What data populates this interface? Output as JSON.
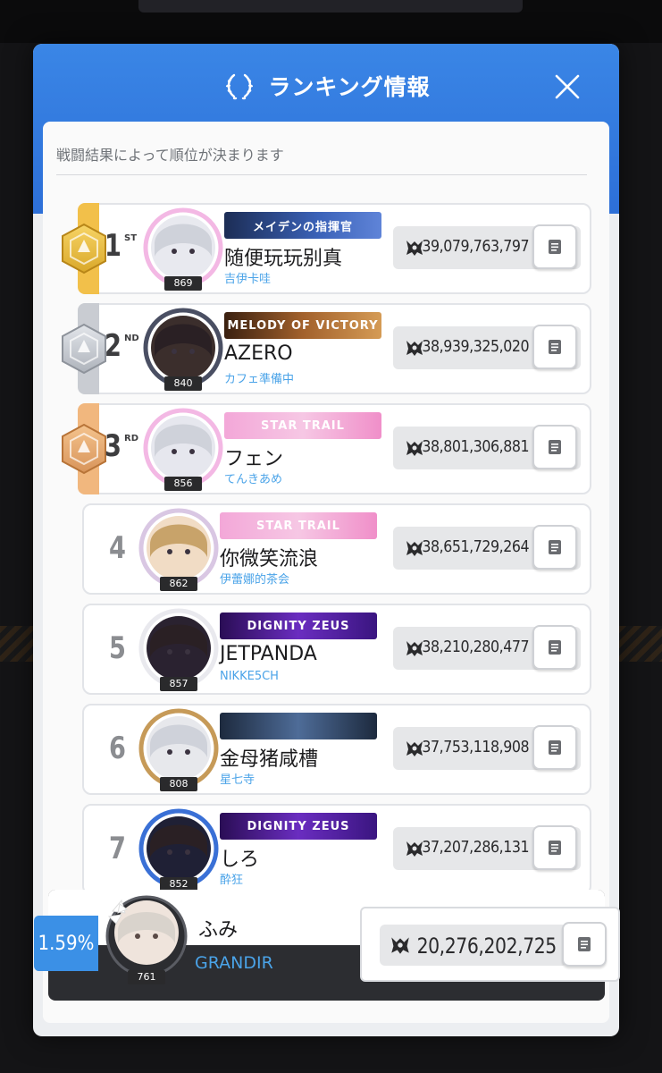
{
  "header": {
    "title": "ランキング情報",
    "close_icon": "close-icon",
    "laurel_icon": "laurel-icon"
  },
  "subtitle": "戦闘結果によって順位が決まります",
  "accent_color": "#2d6fd8",
  "rankings": [
    {
      "rank": "1",
      "suffix": "ST",
      "medal": "gold",
      "level": "869",
      "banner": "メイデンの指揮官",
      "name": "随便玩玩别真",
      "guild": "吉伊卡哇",
      "score": "39,079,763,797"
    },
    {
      "rank": "2",
      "suffix": "ND",
      "medal": "silver",
      "level": "840",
      "banner": "MELODY OF VICTORY",
      "name": "AZERO",
      "guild": "カフェ準備中",
      "score": "38,939,325,020"
    },
    {
      "rank": "3",
      "suffix": "RD",
      "medal": "bronze",
      "level": "856",
      "banner": "STAR TRAIL",
      "name": "フェン",
      "guild": "てんきあめ",
      "score": "38,801,306,881"
    },
    {
      "rank": "4",
      "suffix": "",
      "medal": "",
      "level": "862",
      "banner": "STAR TRAIL",
      "name": "你微笑流浪",
      "guild": "伊蕾娜的茶会",
      "score": "38,651,729,264"
    },
    {
      "rank": "5",
      "suffix": "",
      "medal": "",
      "level": "857",
      "banner": "DIGNITY ZEUS",
      "name": "JETPANDA",
      "guild": "NIKKE5CH",
      "score": "38,210,280,477"
    },
    {
      "rank": "6",
      "suffix": "",
      "medal": "",
      "level": "808",
      "banner": "",
      "name": "金母猪咸槽",
      "guild": "星七寺",
      "score": "37,753,118,908"
    },
    {
      "rank": "7",
      "suffix": "",
      "medal": "",
      "level": "852",
      "banner": "DIGNITY ZEUS",
      "name": "しろ",
      "guild": "酔狂",
      "score": "37,207,286,131"
    }
  ],
  "my_rank": {
    "percent": "1.59%",
    "level": "761",
    "name": "ふみ",
    "guild": "GRANDIR",
    "score": "20,276,202,725"
  },
  "score_icon": "emblem-icon",
  "detail_icon": "document-icon"
}
